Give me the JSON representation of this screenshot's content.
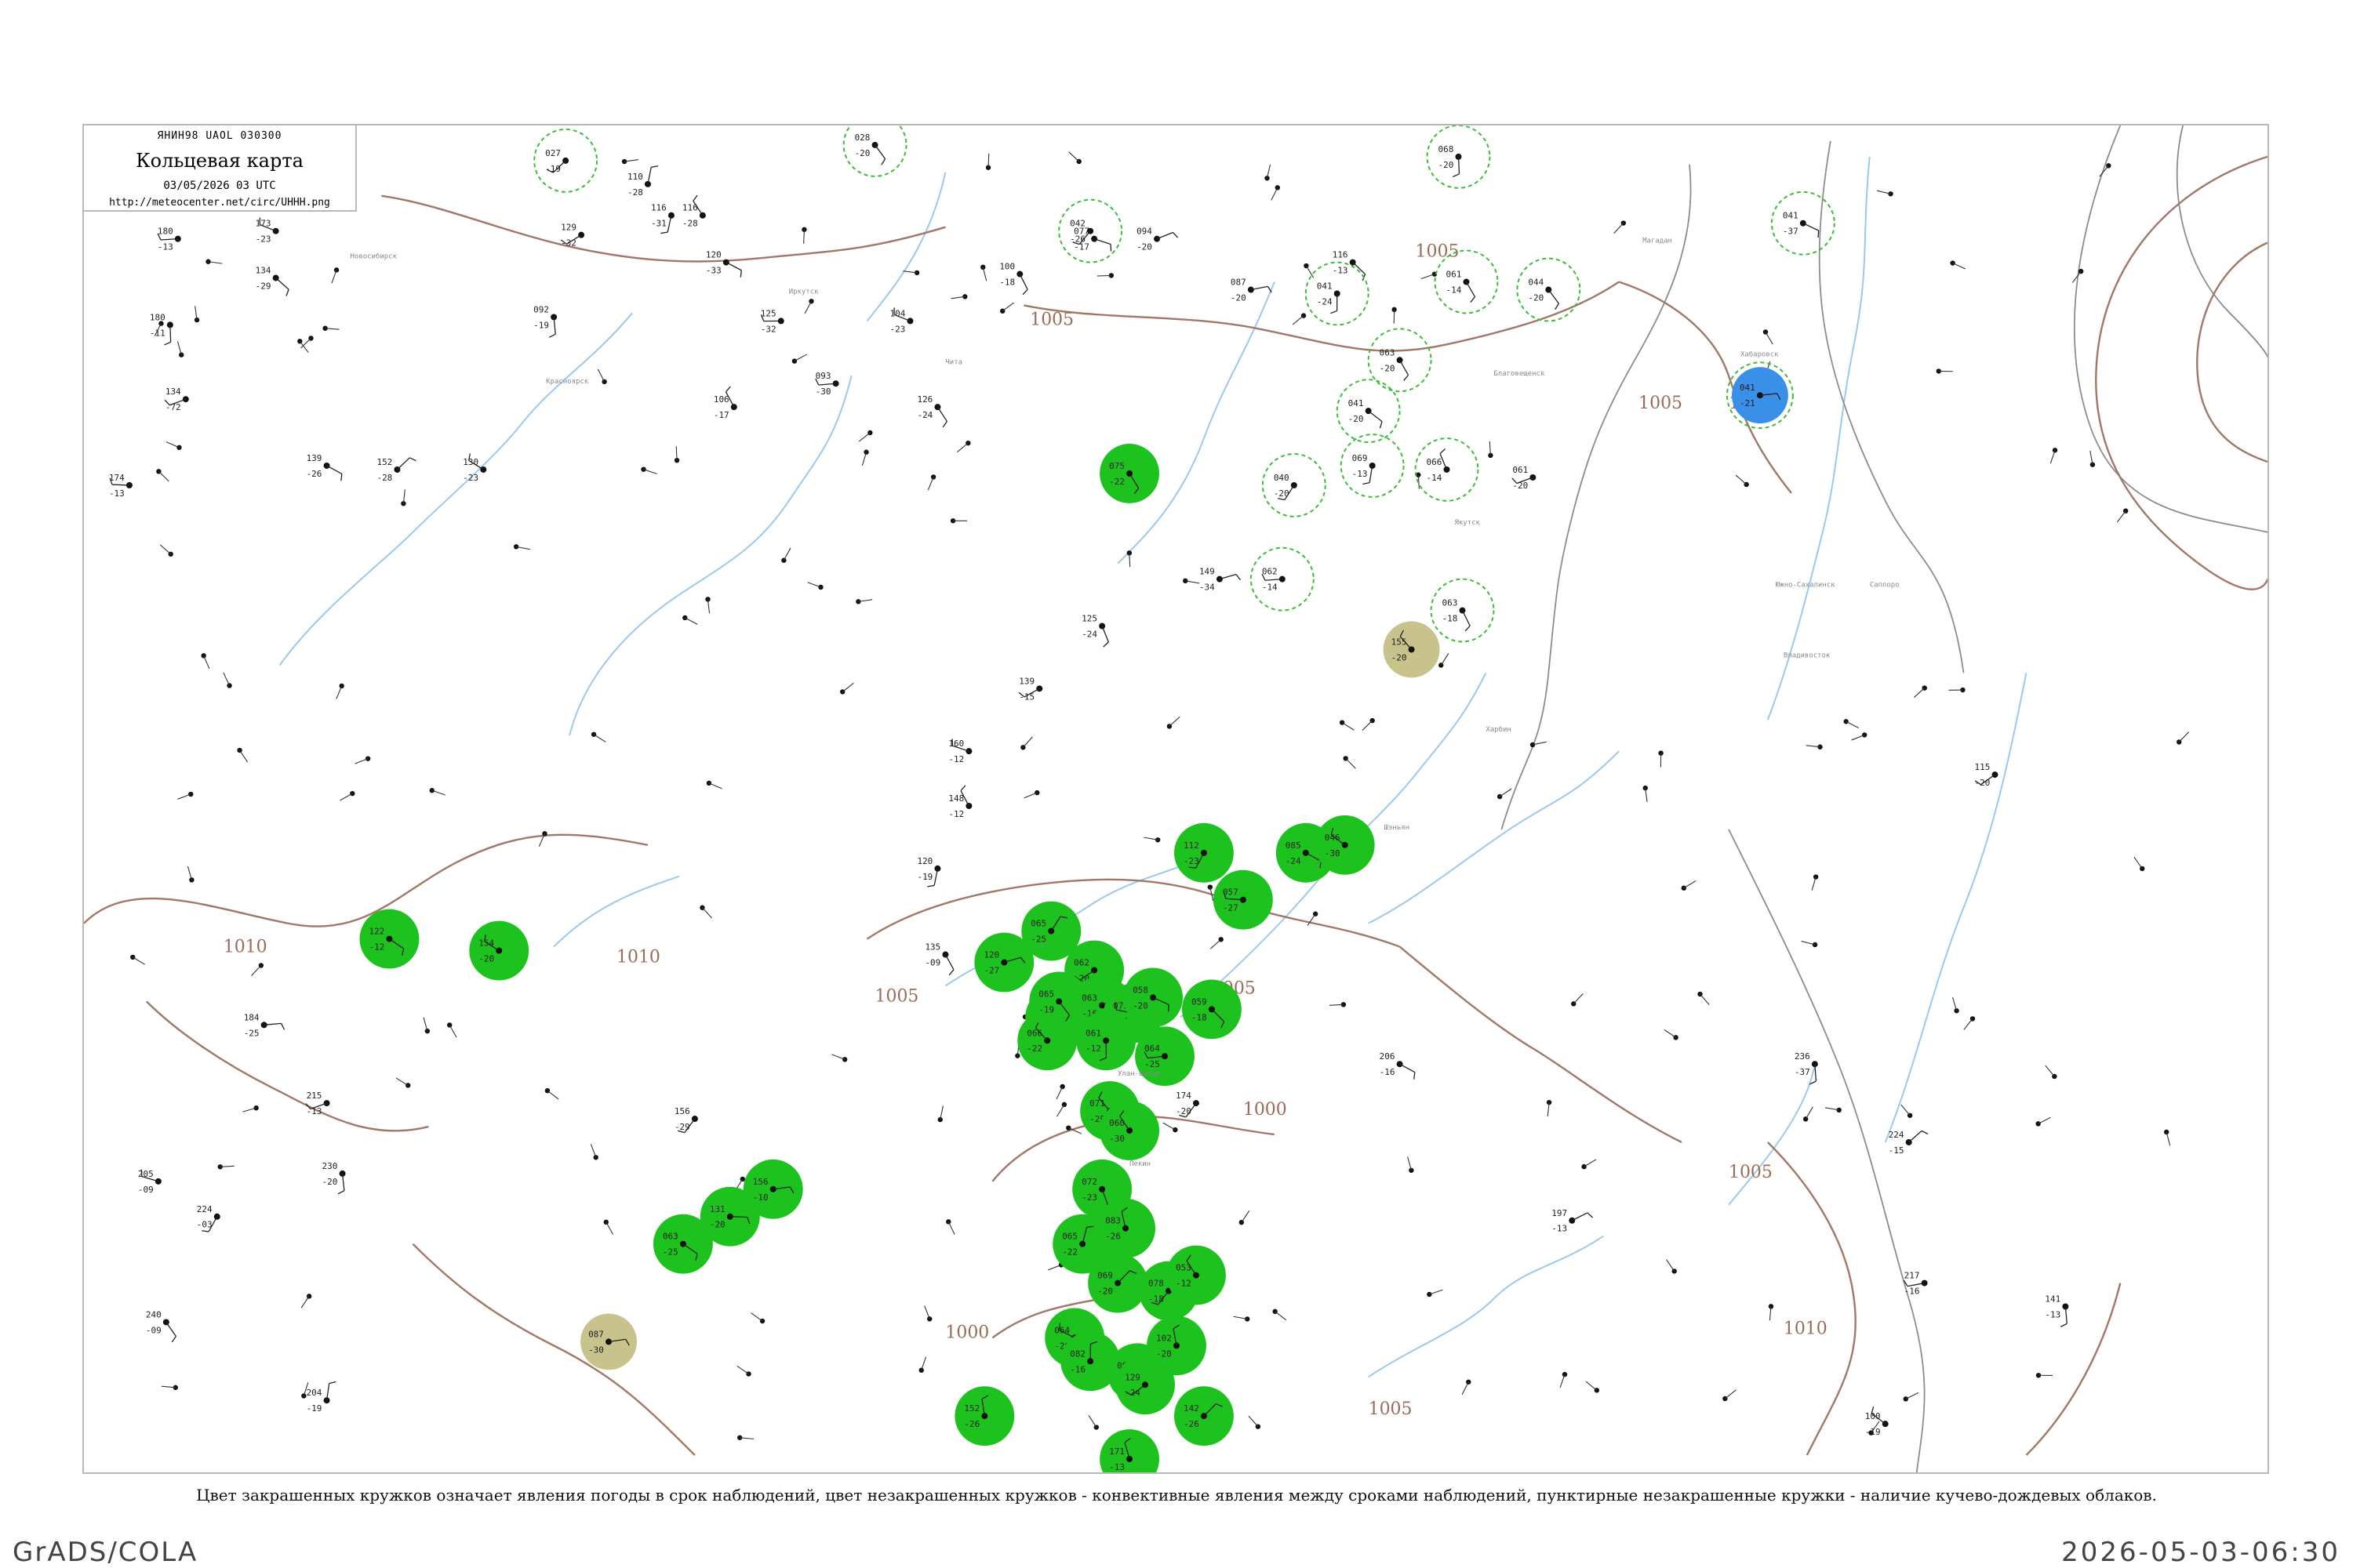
{
  "legend": {
    "code": "ЯНИН98 UAOL 030300",
    "title": "Кольцевая карта",
    "date": "03/05/2026 03 UTC",
    "url": "http://meteocenter.net/circ/UHHH.png"
  },
  "caption": "Цвет закрашенных кружков означает явления погоды в срок наблюдений, цвет незакрашенных кружков - конвективные явления между сроками наблюдений, пунктирные незакрашенные кружки - наличие кучево-дождевых облаков.",
  "footer": {
    "left": "GrADS/COLA",
    "right": "2026-05-03-06:30"
  },
  "colors": {
    "rain_fill": "#1ec21e",
    "fog_fill": "#c8c28c",
    "snow_fill": "#3a8fe8",
    "cb_ring": "#3dbb3d",
    "isobar": "#a07868",
    "river": "#9dc8ee",
    "coast": "#8c8c8c"
  },
  "isobar_labels": [
    {
      "id": "iso-1010-west",
      "text": "1010"
    },
    {
      "id": "iso-1005-north",
      "text": "1005"
    },
    {
      "id": "iso-1005-ne",
      "text": "1005"
    },
    {
      "id": "iso-1005-east1",
      "text": "1005"
    },
    {
      "id": "iso-1005-east2",
      "text": "1005"
    },
    {
      "id": "iso-1010-mid",
      "text": "1010"
    },
    {
      "id": "iso-1005-mid1",
      "text": "1005"
    },
    {
      "id": "iso-1005-mid2",
      "text": "1005"
    },
    {
      "id": "iso-1000-south",
      "text": "1000"
    },
    {
      "id": "iso-1005-se",
      "text": "1005"
    },
    {
      "id": "iso-1010-se",
      "text": "1010"
    },
    {
      "id": "iso-1000-sw",
      "text": "1000"
    },
    {
      "id": "iso-1005-south",
      "text": "1005"
    }
  ],
  "stations": [
    {
      "id": "s1",
      "t": "180",
      "d": "-13"
    },
    {
      "id": "s2",
      "t": "173",
      "d": "-23"
    },
    {
      "id": "s3",
      "t": "134",
      "d": "-29"
    },
    {
      "id": "s4",
      "t": "180",
      "d": "-11"
    },
    {
      "id": "s5",
      "t": "134",
      "d": "-72"
    },
    {
      "id": "s6",
      "t": "174",
      "d": "-13"
    },
    {
      "id": "s7",
      "t": "139",
      "d": "-26"
    },
    {
      "id": "s8",
      "t": "152",
      "d": "-28"
    },
    {
      "id": "s9",
      "t": "130",
      "d": "-23"
    },
    {
      "id": "s10",
      "t": "129",
      "d": "-32"
    },
    {
      "id": "s11",
      "t": "116",
      "d": "-31"
    },
    {
      "id": "s12",
      "t": "110",
      "d": "-28"
    },
    {
      "id": "s13",
      "t": "116",
      "d": "-28"
    },
    {
      "id": "s14",
      "t": "120",
      "d": "-33"
    },
    {
      "id": "s15",
      "t": "125",
      "d": "-32"
    },
    {
      "id": "s16",
      "t": "092",
      "d": "-19"
    },
    {
      "id": "s17",
      "t": "106",
      "d": "-17"
    },
    {
      "id": "s18",
      "t": "126",
      "d": "-24"
    },
    {
      "id": "s19",
      "t": "104",
      "d": "-23"
    },
    {
      "id": "s20",
      "t": "093",
      "d": "-30"
    },
    {
      "id": "s21",
      "t": "100",
      "d": "-18"
    },
    {
      "id": "s22",
      "t": "077",
      "d": "-17"
    },
    {
      "id": "s23",
      "t": "094",
      "d": "-20"
    },
    {
      "id": "s24",
      "t": "087",
      "d": "-20"
    },
    {
      "id": "s25",
      "t": "116",
      "d": "-13"
    },
    {
      "id": "s26",
      "t": "061",
      "d": "-20"
    },
    {
      "id": "s27",
      "t": "149",
      "d": "-34"
    },
    {
      "id": "s28",
      "t": "125",
      "d": "-24"
    },
    {
      "id": "s29",
      "t": "139",
      "d": "-15"
    },
    {
      "id": "s30",
      "t": "160",
      "d": "-12"
    },
    {
      "id": "s31",
      "t": "148",
      "d": "-12"
    },
    {
      "id": "s32",
      "t": "120",
      "d": "-19"
    },
    {
      "id": "s33",
      "t": "135",
      "d": "-09"
    },
    {
      "id": "s34",
      "t": "184",
      "d": "-25"
    },
    {
      "id": "s35",
      "t": "215",
      "d": "-13"
    },
    {
      "id": "s36",
      "t": "230",
      "d": "-20"
    },
    {
      "id": "s37",
      "t": "205",
      "d": "-09"
    },
    {
      "id": "s38",
      "t": "224",
      "d": "-03"
    },
    {
      "id": "s39",
      "t": "240",
      "d": "-09"
    },
    {
      "id": "s40",
      "t": "204",
      "d": "-19"
    },
    {
      "id": "s41",
      "t": "156",
      "d": "-29"
    },
    {
      "id": "s42",
      "t": "174",
      "d": "-20"
    },
    {
      "id": "s43",
      "t": "206",
      "d": "-16"
    },
    {
      "id": "s44",
      "t": "197",
      "d": "-13"
    },
    {
      "id": "s45",
      "t": "236",
      "d": "-37"
    },
    {
      "id": "s46",
      "t": "224",
      "d": "-15"
    },
    {
      "id": "s47",
      "t": "217",
      "d": "-16"
    },
    {
      "id": "s48",
      "t": "141",
      "d": "-13"
    },
    {
      "id": "s49",
      "t": "100",
      "d": "-19"
    },
    {
      "id": "s50",
      "t": "115",
      "d": "-20"
    }
  ],
  "rain_markers": [
    {
      "id": "r1",
      "t": "075",
      "d": "-22"
    },
    {
      "id": "r2",
      "t": "122",
      "d": "-12"
    },
    {
      "id": "r3",
      "t": "154",
      "d": "-20"
    },
    {
      "id": "r4",
      "t": "112",
      "d": "-23"
    },
    {
      "id": "r5",
      "t": "057",
      "d": "-27"
    },
    {
      "id": "r6",
      "t": "085",
      "d": "-24"
    },
    {
      "id": "r7",
      "t": "046",
      "d": "-30"
    },
    {
      "id": "r8",
      "t": "065",
      "d": "-25"
    },
    {
      "id": "r9",
      "t": "120",
      "d": "-27"
    },
    {
      "id": "r10",
      "t": "062",
      "d": "-20"
    },
    {
      "id": "r11",
      "t": "061",
      "d": "-13"
    },
    {
      "id": "r12",
      "t": "066",
      "d": "-22"
    },
    {
      "id": "r13",
      "t": "065",
      "d": "-19"
    },
    {
      "id": "r14",
      "t": "063",
      "d": "-16"
    },
    {
      "id": "r15",
      "t": "073",
      "d": "-21"
    },
    {
      "id": "r16",
      "t": "061",
      "d": "-12"
    },
    {
      "id": "r17",
      "t": "064",
      "d": "-25"
    },
    {
      "id": "r18",
      "t": "058",
      "d": "-20"
    },
    {
      "id": "r19",
      "t": "059",
      "d": "-18"
    },
    {
      "id": "r20",
      "t": "071",
      "d": "-29"
    },
    {
      "id": "r21",
      "t": "060",
      "d": "-30"
    },
    {
      "id": "r22",
      "t": "072",
      "d": "-23"
    },
    {
      "id": "r23",
      "t": "065",
      "d": "-22"
    },
    {
      "id": "r24",
      "t": "083",
      "d": "-26"
    },
    {
      "id": "r25",
      "t": "069",
      "d": "-20"
    },
    {
      "id": "r26",
      "t": "078",
      "d": "-18"
    },
    {
      "id": "r27",
      "t": "053",
      "d": "-12"
    },
    {
      "id": "r28",
      "t": "064",
      "d": "-20"
    },
    {
      "id": "r29",
      "t": "082",
      "d": "-16"
    },
    {
      "id": "r30",
      "t": "092",
      "d": "-20"
    },
    {
      "id": "r31",
      "t": "102",
      "d": "-20"
    },
    {
      "id": "r32",
      "t": "129",
      "d": "-24"
    },
    {
      "id": "r33",
      "t": "142",
      "d": "-26"
    },
    {
      "id": "r34",
      "t": "152",
      "d": "-26"
    },
    {
      "id": "r35",
      "t": "171",
      "d": "-13"
    },
    {
      "id": "r36",
      "t": "156",
      "d": "-10"
    },
    {
      "id": "r37",
      "t": "131",
      "d": "-20"
    },
    {
      "id": "r38",
      "t": "063",
      "d": "-25"
    }
  ],
  "fog_markers": [
    {
      "id": "f1",
      "t": "155",
      "d": "-20"
    },
    {
      "id": "f2",
      "t": "087",
      "d": "-30"
    }
  ],
  "snow_markers": [
    {
      "id": "b1",
      "t": "041",
      "d": "-21"
    }
  ],
  "cb_rings": [
    {
      "id": "c1",
      "t": "027",
      "d": "-19"
    },
    {
      "id": "c2",
      "t": "028",
      "d": "-20"
    },
    {
      "id": "c3",
      "t": "042",
      "d": "-26"
    },
    {
      "id": "c4",
      "t": "041",
      "d": "-24"
    },
    {
      "id": "c5",
      "t": "068",
      "d": "-20"
    },
    {
      "id": "c6",
      "t": "061",
      "d": "-14"
    },
    {
      "id": "c7",
      "t": "044",
      "d": "-20"
    },
    {
      "id": "c8",
      "t": "063",
      "d": "-20"
    },
    {
      "id": "c9",
      "t": "069",
      "d": "-13"
    },
    {
      "id": "c10",
      "t": "062",
      "d": "-14"
    },
    {
      "id": "c11",
      "t": "040",
      "d": "-20"
    },
    {
      "id": "c12",
      "t": "041",
      "d": "-20"
    },
    {
      "id": "c13",
      "t": "066",
      "d": "-14"
    },
    {
      "id": "c14",
      "t": "063",
      "d": "-18"
    },
    {
      "id": "c15",
      "t": "041",
      "d": "-37"
    }
  ],
  "place_names": [
    {
      "id": "p1",
      "text": "Новосибирск"
    },
    {
      "id": "p2",
      "text": "Красноярск"
    },
    {
      "id": "p3",
      "text": "Иркутск"
    },
    {
      "id": "p4",
      "text": "Чита"
    },
    {
      "id": "p5",
      "text": "Благовещенск"
    },
    {
      "id": "p6",
      "text": "Хабаровск"
    },
    {
      "id": "p7",
      "text": "Владивосток"
    },
    {
      "id": "p8",
      "text": "Якутск"
    },
    {
      "id": "p9",
      "text": "Магадан"
    },
    {
      "id": "p10",
      "text": "Южно-Сахалинск"
    },
    {
      "id": "p11",
      "text": "Улан-Батор"
    },
    {
      "id": "p12",
      "text": "Харбин"
    },
    {
      "id": "p13",
      "text": "Шэньян"
    },
    {
      "id": "p14",
      "text": "Пекин"
    },
    {
      "id": "p15",
      "text": "Саппоро"
    }
  ]
}
